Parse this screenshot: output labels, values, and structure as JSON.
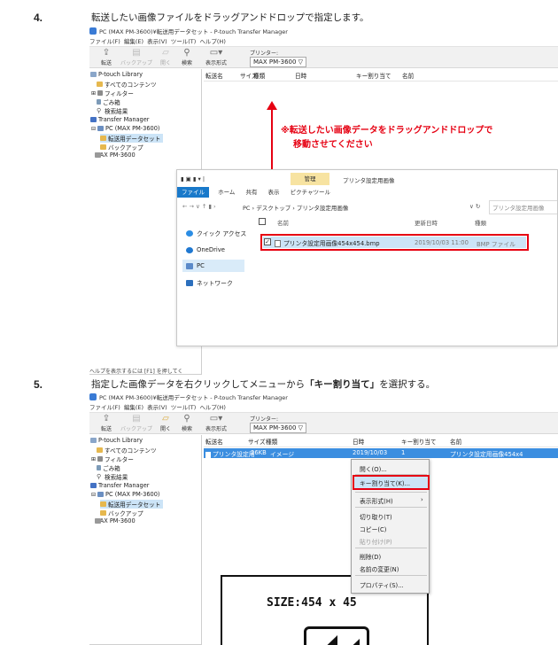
{
  "step4": {
    "number": "4.",
    "caption": "転送したい画像ファイルをドラッグアンドドロップで指定します。"
  },
  "step5": {
    "number": "5.",
    "caption_pre": "指定した画像データを右クリックしてメニューから",
    "caption_bold": "「キー割り当て」",
    "caption_post": "を選択する。"
  },
  "app1": {
    "title": "PC (MAX PM-3600)¥転送用データセット - P-touch Transfer Manager",
    "menu": [
      "ファイル(F)",
      "編集(E)",
      "表示(V)",
      "ツール(T)",
      "ヘルプ(H)"
    ],
    "toolbar": [
      "転送",
      "バックアップ",
      "開く",
      "検索",
      "表示形式"
    ],
    "printer_label": "プリンター:",
    "printer_value": "MAX PM-3600 ▽",
    "tree": [
      "P-touch Library",
      "すべてのコンテンツ",
      "フィルター",
      "ごみ箱",
      "検索結果",
      "Transfer Manager",
      "PC (MAX PM-3600)",
      "転送用データセット",
      "バックアップ",
      "MAX PM-3600"
    ],
    "columns": [
      "転送名",
      "サイズ",
      "種類",
      "日時",
      "キー割り当て",
      "名前"
    ],
    "status": "ヘルプを表示するには [F1] を押してく"
  },
  "annotation": {
    "line1": "※転送したい画像データをドラッグアンドドロップで",
    "line2": "移動させてください"
  },
  "explorer": {
    "manage": "管理",
    "title": "プリンタ設定用画像",
    "ribbon": [
      "ファイル",
      "ホーム",
      "共有",
      "表示",
      "ピクチャツール"
    ],
    "address": "PC  ›  デスクトップ  ›  プリンタ設定用画像",
    "search_placeholder": "プリンタ設定用画像",
    "nav": [
      "クイック アクセス",
      "OneDrive",
      "PC",
      "ネットワーク"
    ],
    "col_name": "名前",
    "col_date": "更新日時",
    "col_type": "種類",
    "file_name": "プリンタ設定用画像454x454.bmp",
    "file_date": "2019/10/03 11:00",
    "file_type": "BMP ファイル"
  },
  "app2": {
    "title": "PC (MAX PM-3600)¥転送用データセット - P-touch Transfer Manager",
    "menu": [
      "ファイル(F)",
      "編集(E)",
      "表示(V)",
      "ツール(T)",
      "ヘルプ(H)"
    ],
    "toolbar": [
      "転送",
      "バックアップ",
      "開く",
      "検索",
      "表示形式"
    ],
    "printer_label": "プリンター:",
    "printer_value": "MAX PM-3600 ▽",
    "tree": [
      "P-touch Library",
      "すべてのコンテンツ",
      "フィルター",
      "ごみ箱",
      "検索結果",
      "Transfer Manager",
      "PC (MAX PM-3600)",
      "転送用データセット",
      "バックアップ",
      "MAX PM-3600"
    ],
    "columns": [
      "転送名",
      "サイズ",
      "種類",
      "日時",
      "キー割り当て",
      "名前"
    ],
    "row": {
      "name": "プリンタ設定用",
      "size": "26KB",
      "type": "イメージ",
      "date": "2019/10/03",
      "key": "1",
      "fullname": "プリンタ設定用画像454x4"
    },
    "context_menu": [
      "開く(O)...",
      "キー割り当て(K)...",
      "表示形式(H)",
      "切り取り(T)",
      "コピー(C)",
      "貼り付け(P)",
      "削除(D)",
      "名前の変更(N)",
      "プロパティ(S)..."
    ],
    "preview_text": "SIZE:454 x 45"
  },
  "colors": {
    "red": "#e60012",
    "selection": "#cce4f7",
    "file_tab": "#1979ca",
    "manage_tab": "#f7e3a1"
  }
}
